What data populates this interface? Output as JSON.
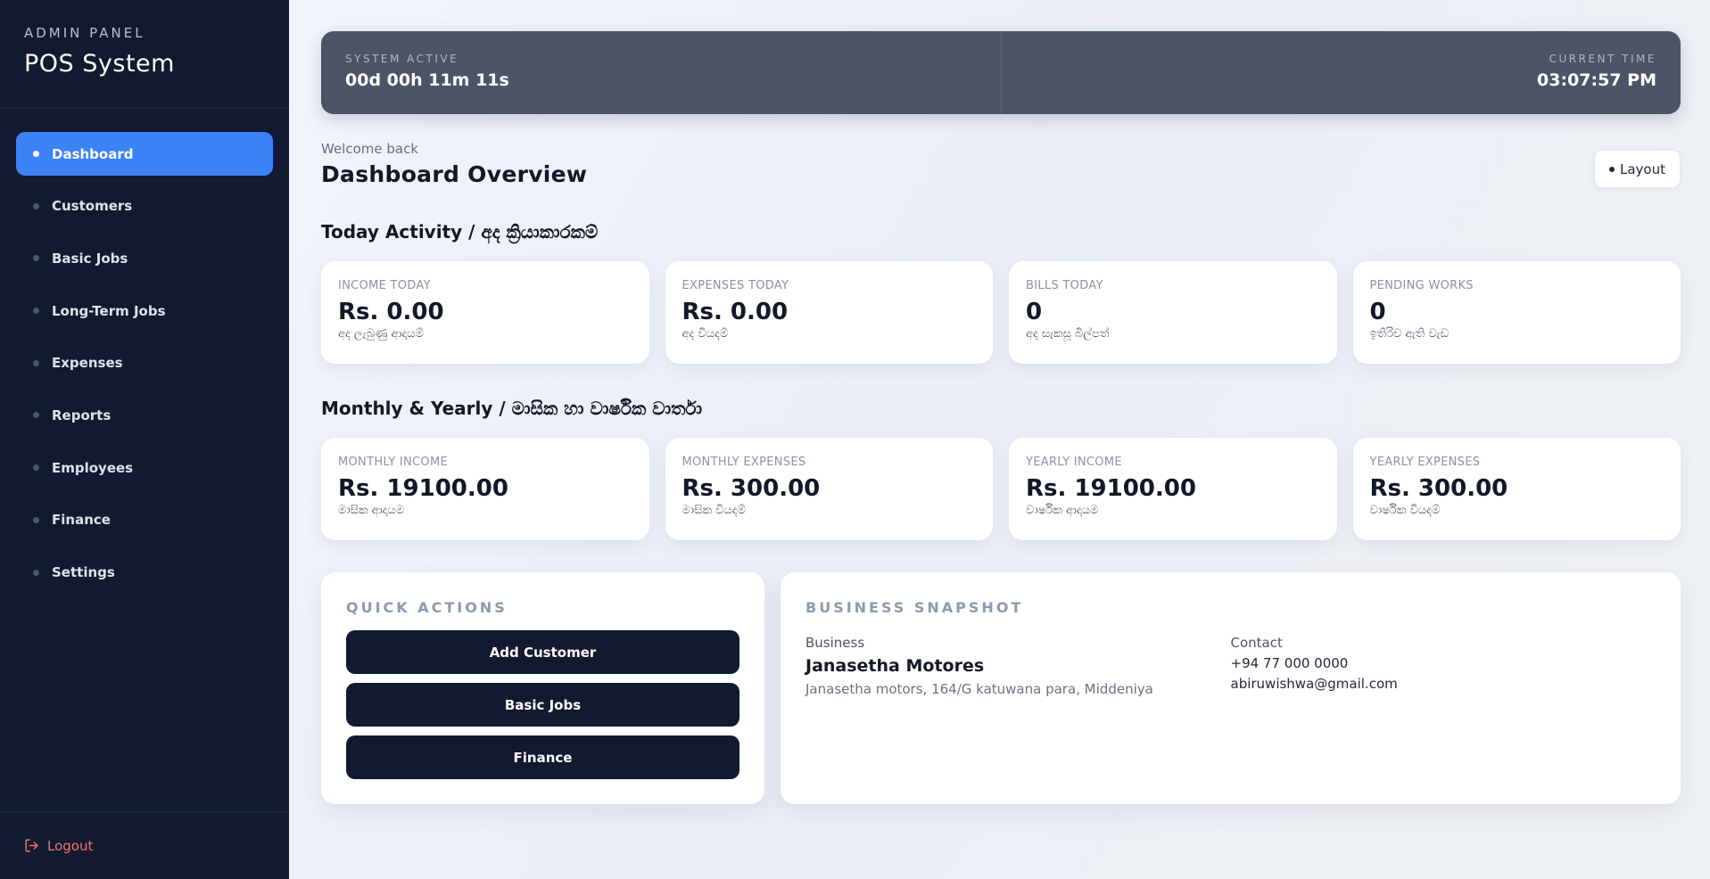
{
  "sidebar": {
    "subtitle": "ADMIN PANEL",
    "title": "POS System",
    "items": [
      {
        "label": "Dashboard"
      },
      {
        "label": "Customers"
      },
      {
        "label": "Basic Jobs"
      },
      {
        "label": "Long-Term Jobs"
      },
      {
        "label": "Expenses"
      },
      {
        "label": "Reports"
      },
      {
        "label": "Employees"
      },
      {
        "label": "Finance"
      },
      {
        "label": "Settings"
      }
    ],
    "active_index": 0,
    "logout_label": "Logout",
    "logout_icon": "logout-icon"
  },
  "topbar": {
    "system_label": "SYSTEM ACTIVE",
    "system_value": "00d 00h 11m 11s",
    "time_label": "CURRENT TIME",
    "time_value": "03:07:57 PM"
  },
  "header": {
    "welcome": "Welcome back",
    "title": "Dashboard Overview",
    "layout_button": "Layout"
  },
  "today": {
    "title": "Today Activity / අද ක්‍රියාකාරකම්",
    "cards": [
      {
        "label": "INCOME TODAY",
        "value": "Rs. 0.00",
        "sub": "අද ලැබුණු ආදායම්"
      },
      {
        "label": "EXPENSES TODAY",
        "value": "Rs. 0.00",
        "sub": "අද වියදම්"
      },
      {
        "label": "BILLS TODAY",
        "value": "0",
        "sub": "අද සැකසූ බිල්පත්"
      },
      {
        "label": "PENDING WORKS",
        "value": "0",
        "sub": "ඉතිරිව ඇති වැඩ"
      }
    ]
  },
  "period": {
    "title": "Monthly & Yearly / මාසික හා වාර්ෂික වාර්තා",
    "cards": [
      {
        "label": "MONTHLY INCOME",
        "value": "Rs. 19100.00",
        "sub": "මාසික ආදායම"
      },
      {
        "label": "MONTHLY EXPENSES",
        "value": "Rs. 300.00",
        "sub": "මාසික වියදම්"
      },
      {
        "label": "YEARLY INCOME",
        "value": "Rs. 19100.00",
        "sub": "වාර්ෂික ආදායම"
      },
      {
        "label": "YEARLY EXPENSES",
        "value": "Rs. 300.00",
        "sub": "වාර්ෂික වියදම්"
      }
    ]
  },
  "quick_actions": {
    "title": "QUICK ACTIONS",
    "buttons": [
      {
        "label": "Add Customer"
      },
      {
        "label": "Basic Jobs"
      },
      {
        "label": "Finance"
      }
    ]
  },
  "snapshot": {
    "title": "BUSINESS SNAPSHOT",
    "business_label": "Business",
    "business_name": "Janasetha Motores",
    "address": "Janasetha motors, 164/G katuwana para, Middeniya",
    "contact_label": "Contact",
    "phone": "+94 77 000 0000",
    "email": "abiruwishwa@gmail.com"
  },
  "colors": {
    "sidebar_bg": "#111a2e",
    "accent": "#3b82f6",
    "topbar_bg": "#4b5567",
    "logout": "#f87171"
  }
}
